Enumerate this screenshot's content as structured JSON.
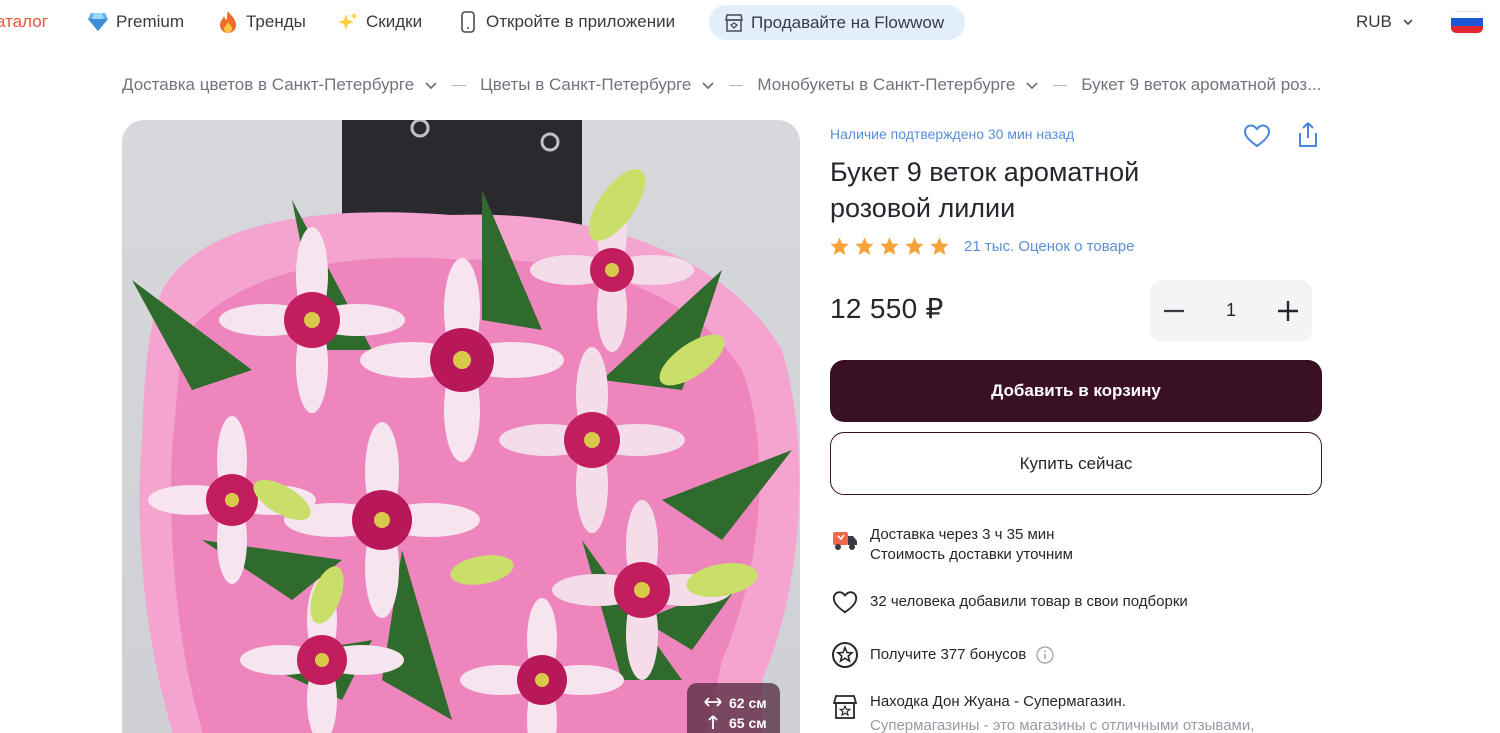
{
  "nav": {
    "catalog": "аталог",
    "items": [
      {
        "label": "Premium",
        "icon": "diamond-icon"
      },
      {
        "label": "Тренды",
        "icon": "fire-icon"
      },
      {
        "label": "Скидки",
        "icon": "sparkles-icon"
      },
      {
        "label": "Откройте в приложении",
        "icon": "phone-icon"
      }
    ],
    "sell": "Продавайте на Flowwow",
    "currency": "RUB"
  },
  "breadcrumbs": [
    "Доставка цветов в Санкт-Петербурге",
    "Цветы в Санкт-Петербурге",
    "Монобукеты в Санкт-Петербурге",
    "Букет 9 веток ароматной роз..."
  ],
  "photo": {
    "width_label": "62 см",
    "height_label": "65 см"
  },
  "product": {
    "availability": "Наличие подтверждено 30 мин назад",
    "title": "Букет 9 веток ароматной розовой лилии",
    "rating_stars": 5,
    "reviews": "21 тыс. Оценок о товаре",
    "price": "12 550 ₽",
    "quantity": "1",
    "add_to_cart": "Добавить в корзину",
    "buy_now": "Купить сейчас"
  },
  "features": {
    "delivery_line1": "Доставка через 3 ч 35 мин",
    "delivery_line2": "Стоимость доставки уточним",
    "favorites": "32 человека добавили товар в свои подборки",
    "bonus": "Получите 377 бонусов",
    "shop_name": "Находка Дон Жуана - Супермагазин.",
    "shop_desc": "Супермагазины - это магазины с отличными отзывами,"
  },
  "colors": {
    "accent": "#3a1024",
    "link": "#5a8fd6",
    "catalog": "#f0533f",
    "star": "#f7a23b",
    "sell_pill": "#e3eefb"
  }
}
